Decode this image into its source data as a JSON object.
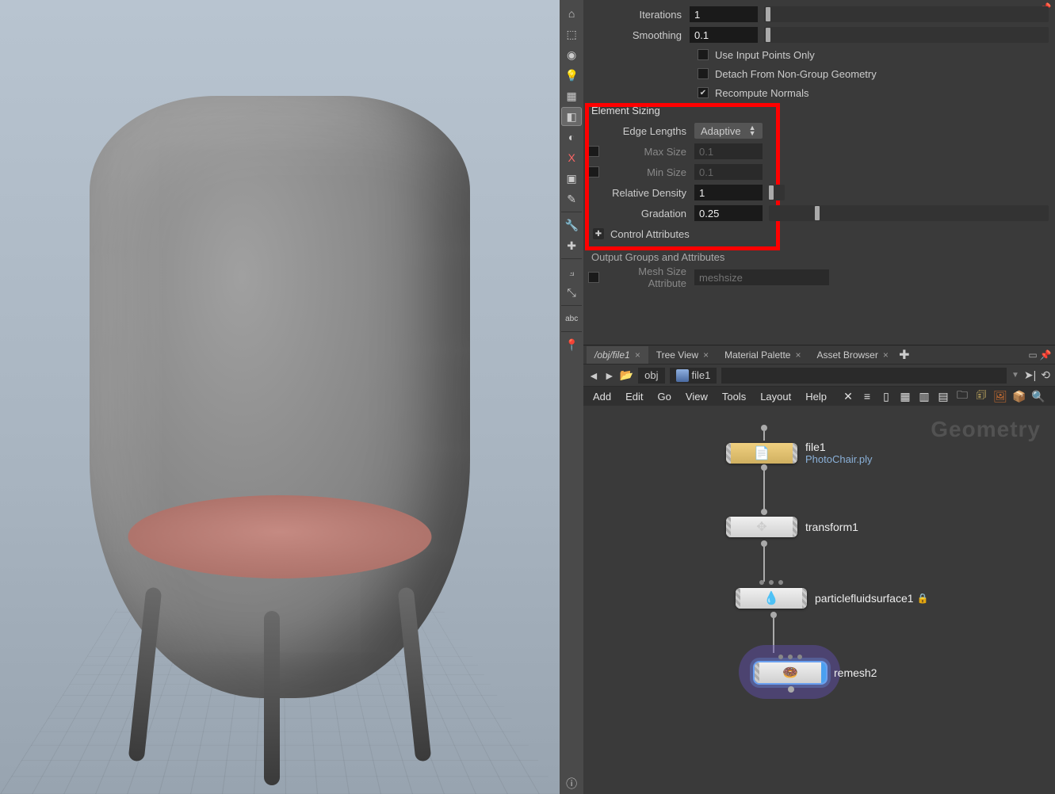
{
  "params": {
    "iterations": {
      "label": "Iterations",
      "value": "1"
    },
    "smoothing": {
      "label": "Smoothing",
      "value": "0.1"
    },
    "use_input_points": "Use Input Points Only",
    "detach": "Detach From Non-Group Geometry",
    "recompute": "Recompute Normals"
  },
  "element_sizing": {
    "header": "Element Sizing",
    "edge_lengths": {
      "label": "Edge Lengths",
      "value": "Adaptive"
    },
    "max_size": {
      "label": "Max Size",
      "value": "0.1"
    },
    "min_size": {
      "label": "Min Size",
      "value": "0.1"
    },
    "relative_density": {
      "label": "Relative Density",
      "value": "1"
    },
    "gradation": {
      "label": "Gradation",
      "value": "0.25"
    },
    "control_attributes": "Control Attributes"
  },
  "output_groups": {
    "header": "Output Groups and Attributes",
    "mesh_size_attr": {
      "label": "Mesh Size Attribute",
      "placeholder": "meshsize"
    }
  },
  "network": {
    "tabs": [
      "/obj/file1",
      "Tree View",
      "Material Palette",
      "Asset Browser"
    ],
    "path_context": "obj",
    "path_current": "file1",
    "menu": [
      "Add",
      "Edit",
      "Go",
      "View",
      "Tools",
      "Layout",
      "Help"
    ],
    "watermark": "Geometry",
    "nodes": {
      "file1": {
        "label": "file1",
        "sub": "PhotoChair.ply"
      },
      "transform1": {
        "label": "transform1"
      },
      "particlefluidsurface1": {
        "label": "particlefluidsurface1"
      },
      "remesh2": {
        "label": "remesh2"
      }
    }
  },
  "toolbar_abc": "abc"
}
